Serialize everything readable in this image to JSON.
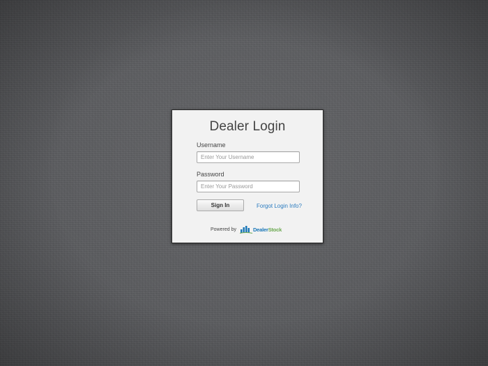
{
  "login": {
    "title": "Dealer Login",
    "username": {
      "label": "Username",
      "value": "",
      "placeholder": "Enter Your Username"
    },
    "password": {
      "label": "Password",
      "value": "",
      "placeholder": "Enter Your Password"
    },
    "sign_in_label": "Sign In",
    "forgot_label": "Forgot Login Info?"
  },
  "footer": {
    "powered_by": "Powered by",
    "brand_part1": "Dealer",
    "brand_part2": "Stock",
    "brand_icon": "bar-chart-logo-icon"
  },
  "colors": {
    "background": "#5a5b5e",
    "panel": "#f2f2f2",
    "link": "#2a7bbf",
    "brand_blue": "#1a77b8",
    "brand_green": "#6aa84f"
  }
}
